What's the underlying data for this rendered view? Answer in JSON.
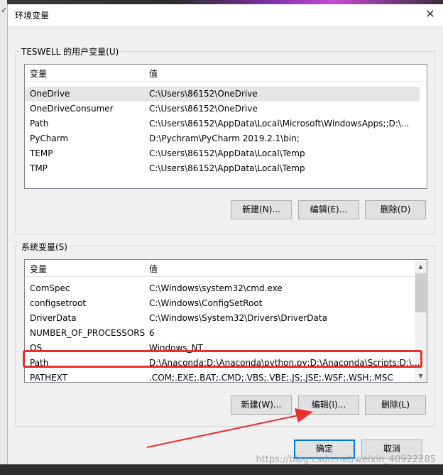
{
  "window": {
    "title": "环境变量",
    "close_icon": "close-icon"
  },
  "user_vars": {
    "group_label": "TESWELL 的用户变量(U)",
    "headers": [
      "变量",
      "值"
    ],
    "rows": [
      {
        "name": "OneDrive",
        "value": "C:\\Users\\86152\\OneDrive"
      },
      {
        "name": "OneDriveConsumer",
        "value": "C:\\Users\\86152\\OneDrive"
      },
      {
        "name": "Path",
        "value": "C:\\Users\\86152\\AppData\\Local\\Microsoft\\WindowsApps;;D:\\..."
      },
      {
        "name": "PyCharm",
        "value": "D:\\Pychram\\PyCharm 2019.2.1\\bin;"
      },
      {
        "name": "TEMP",
        "value": "C:\\Users\\86152\\AppData\\Local\\Temp"
      },
      {
        "name": "TMP",
        "value": "C:\\Users\\86152\\AppData\\Local\\Temp"
      }
    ],
    "selected_row": "OneDrive",
    "buttons": {
      "new": "新建(N)...",
      "edit": "编辑(E)...",
      "delete": "删除(D)"
    }
  },
  "system_vars": {
    "group_label": "系统变量(S)",
    "headers": [
      "变量",
      "值"
    ],
    "rows": [
      {
        "name": "ComSpec",
        "value": "C:\\Windows\\system32\\cmd.exe"
      },
      {
        "name": "configsetroot",
        "value": "C:\\Windows\\ConfigSetRoot"
      },
      {
        "name": "DriverData",
        "value": "C:\\Windows\\System32\\Drivers\\DriverData"
      },
      {
        "name": "NUMBER_OF_PROCESSORS",
        "value": "6"
      },
      {
        "name": "OS",
        "value": "Windows_NT"
      },
      {
        "name": "Path",
        "value": "D:\\Anaconda;D:\\Anaconda\\python.py;D:\\Anaconda\\Scripts;D:\\..."
      },
      {
        "name": "PATHEXT",
        "value": ".COM;.EXE;.BAT;.CMD;.VBS;.VBE;.JS;.JSE;.WSF;.WSH;.MSC"
      }
    ],
    "highlighted_row": "Path",
    "buttons": {
      "new": "新建(W)...",
      "edit": "编辑(I)...",
      "delete": "删除(L)"
    }
  },
  "footer": {
    "ok": "确定",
    "cancel": "取消"
  },
  "annotation": {
    "highlight_color": "#e8302e",
    "arrow_color": "#e8302e"
  },
  "watermark": "https://blog.csdn.net/weixin_40922285"
}
